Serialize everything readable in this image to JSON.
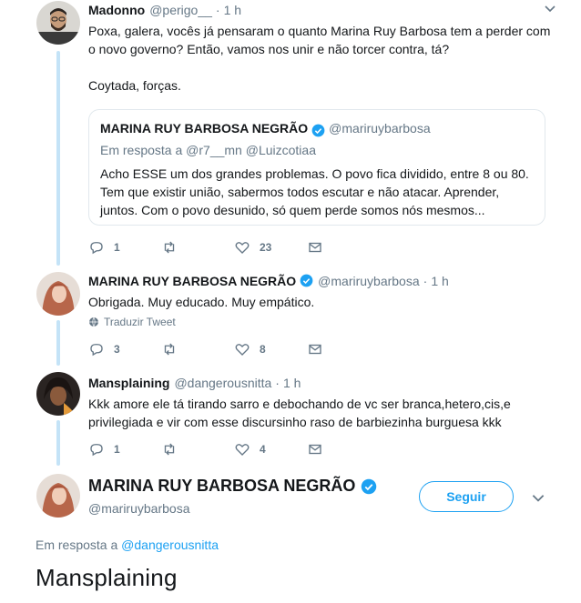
{
  "colors": {
    "accent": "#1da1f2",
    "secondary_text": "#657786",
    "thread_line": "#c4e3f7",
    "border": "#e1e8ed"
  },
  "tweets": [
    {
      "name": "Madonno",
      "handle": "@perigo__",
      "dot": "·",
      "time": "1 h",
      "text_line1": "Poxa, galera, vocês já pensaram o quanto Marina Ruy Barbosa tem a perder com",
      "text_line2": "o novo governo? Então, vamos nos unir e não torcer contra, tá?",
      "text_line3": "Coytada, forças.",
      "quote": {
        "name": "MARINA RUY BARBOSA NEGRÃO",
        "handle": "@mariruybarbosa",
        "reply_prefix": "Em resposta a",
        "reply_to_1": "@r7__mn",
        "reply_to_2": "@Luizcotiaa",
        "line1": "Acho ESSE um dos grandes problemas. O povo fica dividido, entre 8 ou 80.",
        "line2": "Tem que existir união, sabermos todos escutar e não atacar. Aprender,",
        "line3": "juntos. Com o povo desunido, só quem perde somos nós mesmos..."
      },
      "replies": "1",
      "retweets": "",
      "likes": "23"
    },
    {
      "name": "MARINA RUY BARBOSA NEGRÃO",
      "handle": "@mariruybarbosa",
      "dot": "·",
      "time": "1 h",
      "text": "Obrigada. Muy educado. Muy empático.",
      "translate": "Traduzir Tweet",
      "replies": "3",
      "retweets": "",
      "likes": "8"
    },
    {
      "name": "Mansplaining",
      "handle": "@dangerousnitta",
      "dot": "·",
      "time": "1 h",
      "text_line1": "Kkk amore ele tá tirando sarro e debochando de vc ser branca,hetero,cis,e",
      "text_line2": "privilegiada e vir com esse discursinho raso de barbiezinha burguesa kkk",
      "replies": "1",
      "retweets": "",
      "likes": "4"
    }
  ],
  "main_tweet": {
    "name": "MARINA RUY BARBOSA NEGRÃO",
    "handle": "@mariruybarbosa",
    "follow_label": "Seguir",
    "reply_prefix": "Em resposta a",
    "reply_to": "@dangerousnitta",
    "text": "Mansplaining"
  }
}
